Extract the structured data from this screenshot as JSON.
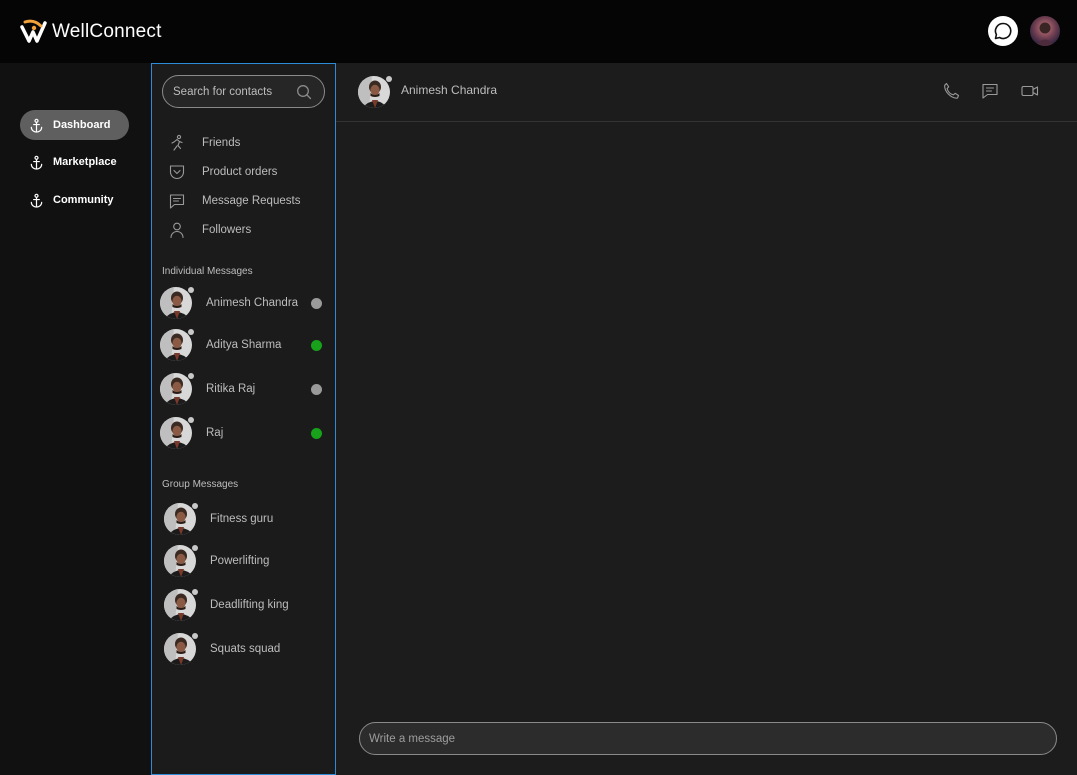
{
  "app": {
    "name": "WellConnect"
  },
  "nav": {
    "items": [
      {
        "label": "Dashboard",
        "icon": "anchor-icon",
        "active": true
      },
      {
        "label": "Marketplace",
        "icon": "anchor-icon",
        "active": false
      },
      {
        "label": "Community",
        "icon": "anchor-icon",
        "active": false
      }
    ]
  },
  "contacts": {
    "search_placeholder": "Search for contacts",
    "menu": [
      {
        "label": "Friends",
        "icon": "running-person-icon"
      },
      {
        "label": "Product orders",
        "icon": "pocket-icon"
      },
      {
        "label": "Message Requests",
        "icon": "message-square-icon"
      },
      {
        "label": "Followers",
        "icon": "user-icon"
      }
    ],
    "individual_title": "Individual Messages",
    "individual": [
      {
        "name": "Animesh Chandra",
        "status": "offline",
        "status_color": "#9a9a9a"
      },
      {
        "name": "Aditya Sharma",
        "status": "online",
        "status_color": "#18a11a"
      },
      {
        "name": "Ritika Raj",
        "status": "offline",
        "status_color": "#9a9a9a"
      },
      {
        "name": "Raj",
        "status": "online",
        "status_color": "#18a11a"
      }
    ],
    "group_title": "Group Messages",
    "groups": [
      {
        "name": "Fitness guru"
      },
      {
        "name": "Powerlifting"
      },
      {
        "name": "Deadlifting king"
      },
      {
        "name": "Squats squad"
      }
    ]
  },
  "conversation": {
    "contact_name": "Animesh Chandra",
    "actions": [
      "phone-icon",
      "message-square-icon",
      "video-icon"
    ],
    "composer_placeholder": "Write a message"
  },
  "colors": {
    "accent_border": "#2d8bd8",
    "online": "#18a11a",
    "offline": "#9a9a9a",
    "active_nav": "#5f5f5f"
  }
}
